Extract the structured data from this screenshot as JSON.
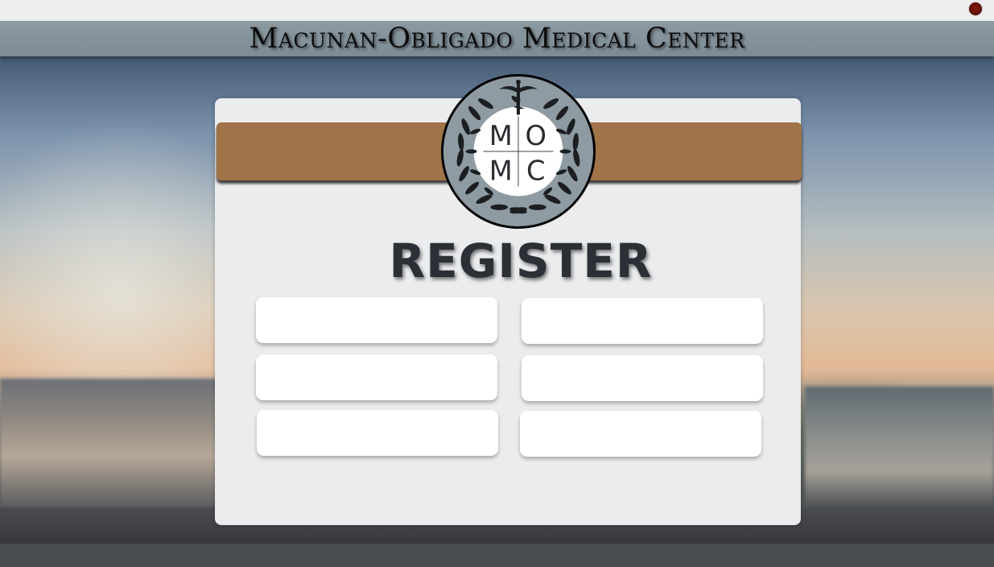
{
  "app": {
    "title": "Macunan-Obligado Medical Center"
  },
  "window": {
    "close_icon": "close-dot-icon",
    "close_color": "#6b1306"
  },
  "logo": {
    "top_left": "M",
    "top_right": "O",
    "bottom_left": "M",
    "bottom_right": "C"
  },
  "register": {
    "title": "REGISTER",
    "fields": [
      {
        "value": "",
        "placeholder": ""
      },
      {
        "value": "",
        "placeholder": ""
      },
      {
        "value": "",
        "placeholder": ""
      },
      {
        "value": "",
        "placeholder": ""
      },
      {
        "value": "",
        "placeholder": ""
      },
      {
        "value": "",
        "placeholder": ""
      }
    ]
  },
  "colors": {
    "header_band": "#8493a0",
    "accent_band": "#a07448",
    "panel": "#ebecee",
    "title_text": "#2b3036"
  }
}
